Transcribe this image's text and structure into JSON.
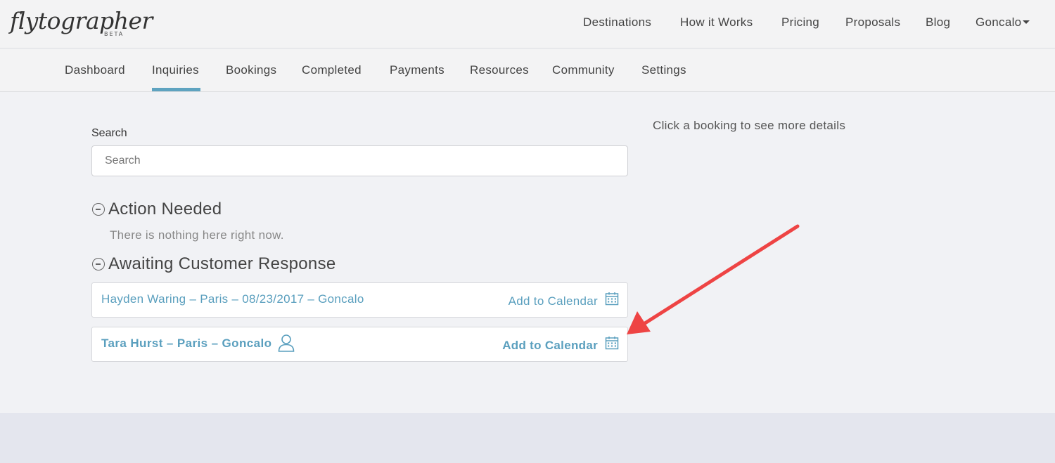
{
  "brand": {
    "logo_text": "flytographer",
    "badge": "BETA"
  },
  "topnav": {
    "destinations": "Destinations",
    "how_it_works": "How it Works",
    "pricing": "Pricing",
    "proposals": "Proposals",
    "blog": "Blog",
    "user": "Goncalo"
  },
  "tabs": {
    "dashboard": "Dashboard",
    "inquiries": "Inquiries",
    "bookings": "Bookings",
    "completed": "Completed",
    "payments": "Payments",
    "resources": "Resources",
    "community": "Community",
    "settings": "Settings",
    "active": "Inquiries"
  },
  "search": {
    "label": "Search",
    "placeholder": "Search",
    "value": ""
  },
  "details_hint": "Click a booking to see more details",
  "sections": {
    "action_needed": {
      "title": "Action Needed",
      "empty_text": "There is nothing here right now."
    },
    "awaiting": {
      "title": "Awaiting Customer Response",
      "rows": [
        {
          "label": "Hayden Waring – Paris – 08/23/2017 – Goncalo",
          "calendar_label": "Add to Calendar"
        },
        {
          "label": "Tara Hurst – Paris – Goncalo",
          "calendar_label": "Add to Calendar"
        }
      ]
    }
  },
  "colors": {
    "link": "#5a9fbe",
    "tab_underline": "#5ea3c0",
    "annotation_arrow": "#ee4444"
  },
  "icons": {
    "section_toggle": "minus-circle-icon",
    "calendar": "calendar-icon",
    "person": "person-icon",
    "caret": "caret-down-icon"
  }
}
